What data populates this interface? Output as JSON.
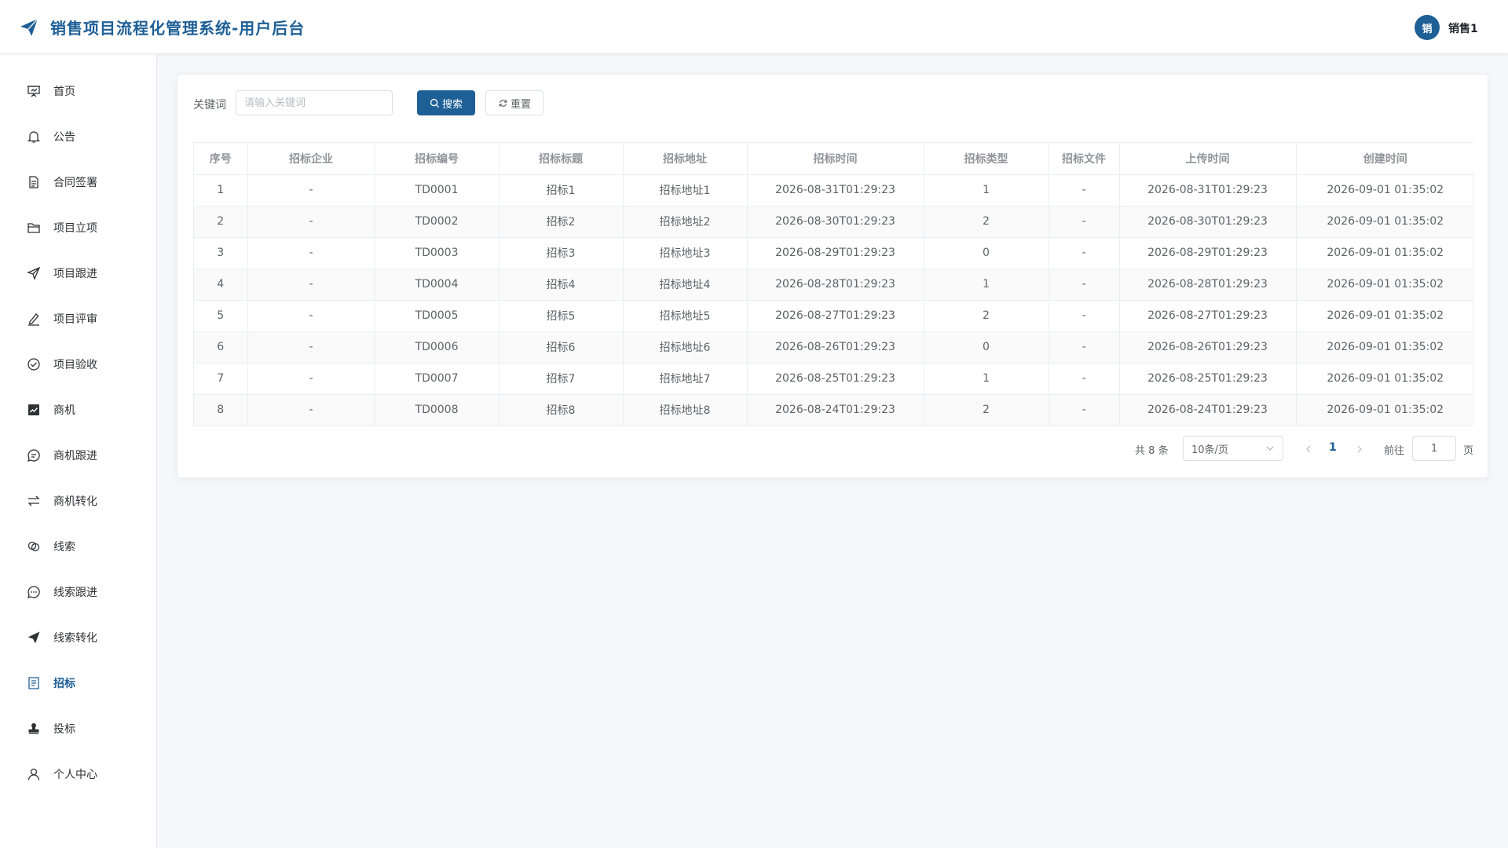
{
  "header": {
    "title": "销售项目流程化管理系统-用户后台",
    "brand_icon": "paper-plane-icon",
    "user": {
      "avatar_text": "销",
      "name": "销售1"
    }
  },
  "sidebar": {
    "items": [
      {
        "label": "首页",
        "icon": "presentation-icon"
      },
      {
        "label": "公告",
        "icon": "bell-icon"
      },
      {
        "label": "合同签署",
        "icon": "document-icon"
      },
      {
        "label": "项目立项",
        "icon": "folder-icon"
      },
      {
        "label": "项目跟进",
        "icon": "send-icon"
      },
      {
        "label": "项目评审",
        "icon": "edit-pen-icon"
      },
      {
        "label": "项目验收",
        "icon": "check-circle-icon"
      },
      {
        "label": "商机",
        "icon": "chart-icon"
      },
      {
        "label": "商机跟进",
        "icon": "chat-icon"
      },
      {
        "label": "商机转化",
        "icon": "switch-icon"
      },
      {
        "label": "线索",
        "icon": "link-icon"
      },
      {
        "label": "线索跟进",
        "icon": "chat-dots-icon"
      },
      {
        "label": "线索转化",
        "icon": "paper-plane-icon"
      },
      {
        "label": "招标",
        "icon": "tickets-icon",
        "active": true
      },
      {
        "label": "投标",
        "icon": "stamp-icon"
      },
      {
        "label": "个人中心",
        "icon": "user-icon"
      }
    ]
  },
  "search": {
    "label": "关键词",
    "placeholder": "请输入关键词",
    "value": "",
    "search_button": "搜索",
    "reset_button": "重置"
  },
  "table": {
    "columns": [
      "序号",
      "招标企业",
      "招标编号",
      "招标标题",
      "招标地址",
      "招标时间",
      "招标类型",
      "招标文件",
      "上传时间",
      "创建时间"
    ],
    "rows": [
      [
        "1",
        "-",
        "TD0001",
        "招标1",
        "招标地址1",
        "2026-08-31T01:29:23",
        "1",
        "-",
        "2026-08-31T01:29:23",
        "2026-09-01 01:35:02"
      ],
      [
        "2",
        "-",
        "TD0002",
        "招标2",
        "招标地址2",
        "2026-08-30T01:29:23",
        "2",
        "-",
        "2026-08-30T01:29:23",
        "2026-09-01 01:35:02"
      ],
      [
        "3",
        "-",
        "TD0003",
        "招标3",
        "招标地址3",
        "2026-08-29T01:29:23",
        "0",
        "-",
        "2026-08-29T01:29:23",
        "2026-09-01 01:35:02"
      ],
      [
        "4",
        "-",
        "TD0004",
        "招标4",
        "招标地址4",
        "2026-08-28T01:29:23",
        "1",
        "-",
        "2026-08-28T01:29:23",
        "2026-09-01 01:35:02"
      ],
      [
        "5",
        "-",
        "TD0005",
        "招标5",
        "招标地址5",
        "2026-08-27T01:29:23",
        "2",
        "-",
        "2026-08-27T01:29:23",
        "2026-09-01 01:35:02"
      ],
      [
        "6",
        "-",
        "TD0006",
        "招标6",
        "招标地址6",
        "2026-08-26T01:29:23",
        "0",
        "-",
        "2026-08-26T01:29:23",
        "2026-09-01 01:35:02"
      ],
      [
        "7",
        "-",
        "TD0007",
        "招标7",
        "招标地址7",
        "2026-08-25T01:29:23",
        "1",
        "-",
        "2026-08-25T01:29:23",
        "2026-09-01 01:35:02"
      ],
      [
        "8",
        "-",
        "TD0008",
        "招标8",
        "招标地址8",
        "2026-08-24T01:29:23",
        "2",
        "-",
        "2026-08-24T01:29:23",
        "2026-09-01 01:35:02"
      ]
    ]
  },
  "pagination": {
    "total": "共 8 条",
    "page_size": "10条/页",
    "current": "1",
    "goto_label": "前往",
    "goto_value": "1",
    "page_unit": "页"
  },
  "colors": {
    "accent": "#1e5f96",
    "background": "#f5f7fa",
    "text": "#606266"
  }
}
